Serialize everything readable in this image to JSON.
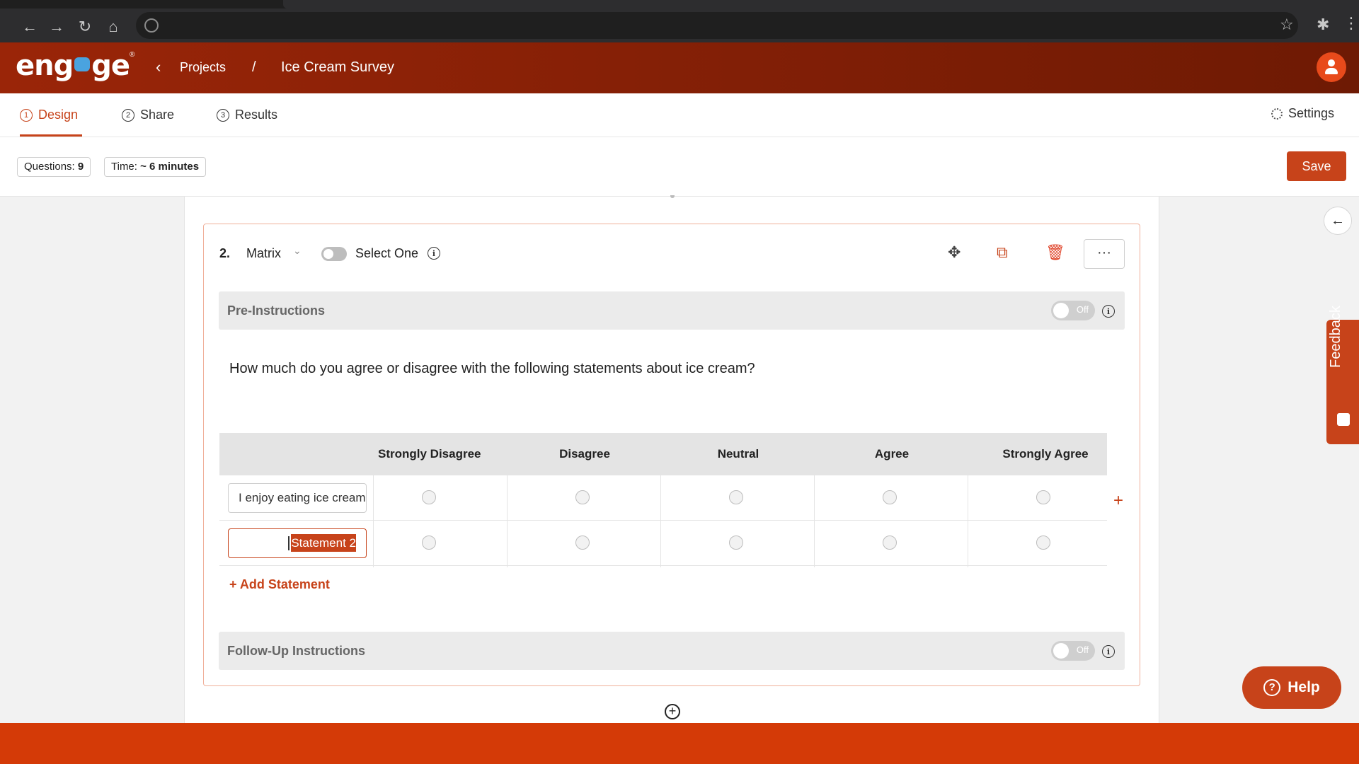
{
  "header": {
    "logo_text_left": "eng",
    "logo_text_right": "ge",
    "logo_reg": "®",
    "breadcrumb_projects": "Projects",
    "breadcrumb_separator": "/",
    "project_title": "Ice Cream Survey"
  },
  "tabs": [
    {
      "num": "1",
      "label": "Design"
    },
    {
      "num": "2",
      "label": "Share"
    },
    {
      "num": "3",
      "label": "Results"
    }
  ],
  "settings_label": "Settings",
  "stats": {
    "questions_label": "Questions:",
    "questions_value": "9",
    "time_label": "Time:",
    "time_value": "~ 6 minutes"
  },
  "save_label": "Save",
  "question": {
    "number": "2.",
    "type": "Matrix",
    "select_one_label": "Select One",
    "more_label": "···",
    "pre_instructions_label": "Pre-Instructions",
    "pre_instructions_state": "Off",
    "text": "How much do you agree or disagree with the following statements about ice cream?",
    "columns": [
      "Strongly Disagree",
      "Disagree",
      "Neutral",
      "Agree",
      "Strongly Agree"
    ],
    "statements": [
      "I enjoy eating ice cream",
      "Statement 2"
    ],
    "add_statement_label": "+ Add Statement",
    "followup_instructions_label": "Follow-Up Instructions",
    "followup_instructions_state": "Off"
  },
  "feedback_label": "Feedback",
  "help_label": "Help",
  "colors": {
    "brand": "#c7431a",
    "header_start": "#9a2508",
    "header_end": "#6e1a04",
    "footer": "#d43a07"
  }
}
